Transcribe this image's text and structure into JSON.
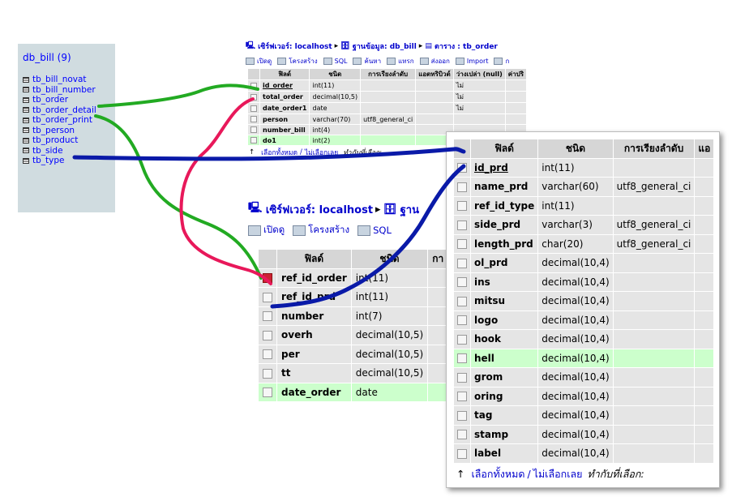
{
  "db_panel": {
    "title": "db_bill (9)",
    "tables": [
      "tb_bill_novat",
      "tb_bill_number",
      "tb_order",
      "tb_order_detail",
      "tb_order_print",
      "tb_person",
      "tb_product",
      "tb_side",
      "tb_type"
    ]
  },
  "window_order": {
    "breadcrumb": {
      "server_label": "เซิร์ฟเวอร์: localhost",
      "db_label": "ฐานข้อมูล: db_bill",
      "table_label": "ตาราง : tb_order"
    },
    "tabs": [
      "เปิดดู",
      "โครงสร้าง",
      "SQL",
      "ค้นหา",
      "แทรก",
      "ส่งออก",
      "Import",
      "ก"
    ],
    "columns": [
      "ฟิลด์",
      "ชนิด",
      "การเรียงลำดับ",
      "แอตทริบิวต์",
      "ว่างเปล่า (null)",
      "ค่าปริ"
    ],
    "rows": [
      {
        "field": "id_order",
        "type": "int(11)",
        "collation": "",
        "null": "ไม่",
        "pk": true
      },
      {
        "field": "total_order",
        "type": "decimal(10,5)",
        "collation": "",
        "null": "ไม่",
        "pk": false
      },
      {
        "field": "date_order1",
        "type": "date",
        "collation": "",
        "null": "ไม่",
        "pk": false
      },
      {
        "field": "person",
        "type": "varchar(70)",
        "collation": "utf8_general_ci",
        "null": "",
        "pk": false
      },
      {
        "field": "number_bill",
        "type": "int(4)",
        "collation": "",
        "null": "",
        "pk": false
      },
      {
        "field": "do1",
        "type": "int(2)",
        "collation": "",
        "null": "",
        "pk": false
      }
    ],
    "footer": {
      "arrow": "↑",
      "check_all": "เลือกทั้งหมด",
      "uncheck_all": "ไม่เลือกเลย",
      "hint": "ทำกับที่เลือก:"
    }
  },
  "window_detail": {
    "breadcrumb": {
      "server_label": "เซิร์ฟเวอร์: localhost",
      "db_label": "ฐาน"
    },
    "tabs": [
      "เปิดดู",
      "โครงสร้าง",
      "SQL"
    ],
    "columns": [
      "ฟิลด์",
      "ชนิด",
      "กา"
    ],
    "rows": [
      {
        "field": "ref_id_order",
        "type": "int(11)",
        "checked": true
      },
      {
        "field": "ref_id_prd",
        "type": "int(11)",
        "checked": false
      },
      {
        "field": "number",
        "type": "int(7)",
        "checked": false
      },
      {
        "field": "overh",
        "type": "decimal(10,5)",
        "checked": false
      },
      {
        "field": "per",
        "type": "decimal(10,5)",
        "checked": false
      },
      {
        "field": "tt",
        "type": "decimal(10,5)",
        "checked": false
      },
      {
        "field": "date_order",
        "type": "date",
        "checked": false
      }
    ]
  },
  "window_product": {
    "columns": [
      "ฟิลด์",
      "ชนิด",
      "การเรียงลำดับ",
      "แอ"
    ],
    "rows": [
      {
        "field": "id_prd",
        "type": "int(11)",
        "collation": "",
        "pk": true
      },
      {
        "field": "name_prd",
        "type": "varchar(60)",
        "collation": "utf8_general_ci",
        "pk": false
      },
      {
        "field": "ref_id_type",
        "type": "int(11)",
        "collation": "",
        "pk": false
      },
      {
        "field": "side_prd",
        "type": "varchar(3)",
        "collation": "utf8_general_ci",
        "pk": false
      },
      {
        "field": "length_prd",
        "type": "char(20)",
        "collation": "utf8_general_ci",
        "pk": false
      },
      {
        "field": "ol_prd",
        "type": "decimal(10,4)",
        "collation": "",
        "pk": false
      },
      {
        "field": "ins",
        "type": "decimal(10,4)",
        "collation": "",
        "pk": false
      },
      {
        "field": "mitsu",
        "type": "decimal(10,4)",
        "collation": "",
        "pk": false
      },
      {
        "field": "logo",
        "type": "decimal(10,4)",
        "collation": "",
        "pk": false
      },
      {
        "field": "hook",
        "type": "decimal(10,4)",
        "collation": "",
        "pk": false
      },
      {
        "field": "hell",
        "type": "decimal(10,4)",
        "collation": "",
        "pk": false
      },
      {
        "field": "grom",
        "type": "decimal(10,4)",
        "collation": "",
        "pk": false
      },
      {
        "field": "oring",
        "type": "decimal(10,4)",
        "collation": "",
        "pk": false
      },
      {
        "field": "tag",
        "type": "decimal(10,4)",
        "collation": "",
        "pk": false
      },
      {
        "field": "stamp",
        "type": "decimal(10,4)",
        "collation": "",
        "pk": false
      },
      {
        "field": "label",
        "type": "decimal(10,4)",
        "collation": "",
        "pk": false
      }
    ],
    "footer": {
      "arrow": "↑",
      "check_all": "เลือกทั้งหมด",
      "uncheck_all": "ไม่เลือกเลย",
      "hint": "ทำกับที่เลือก:"
    }
  },
  "annotation_colors": {
    "green": "#22aa22",
    "red": "#e8185a",
    "blue": "#0a1aa8"
  }
}
